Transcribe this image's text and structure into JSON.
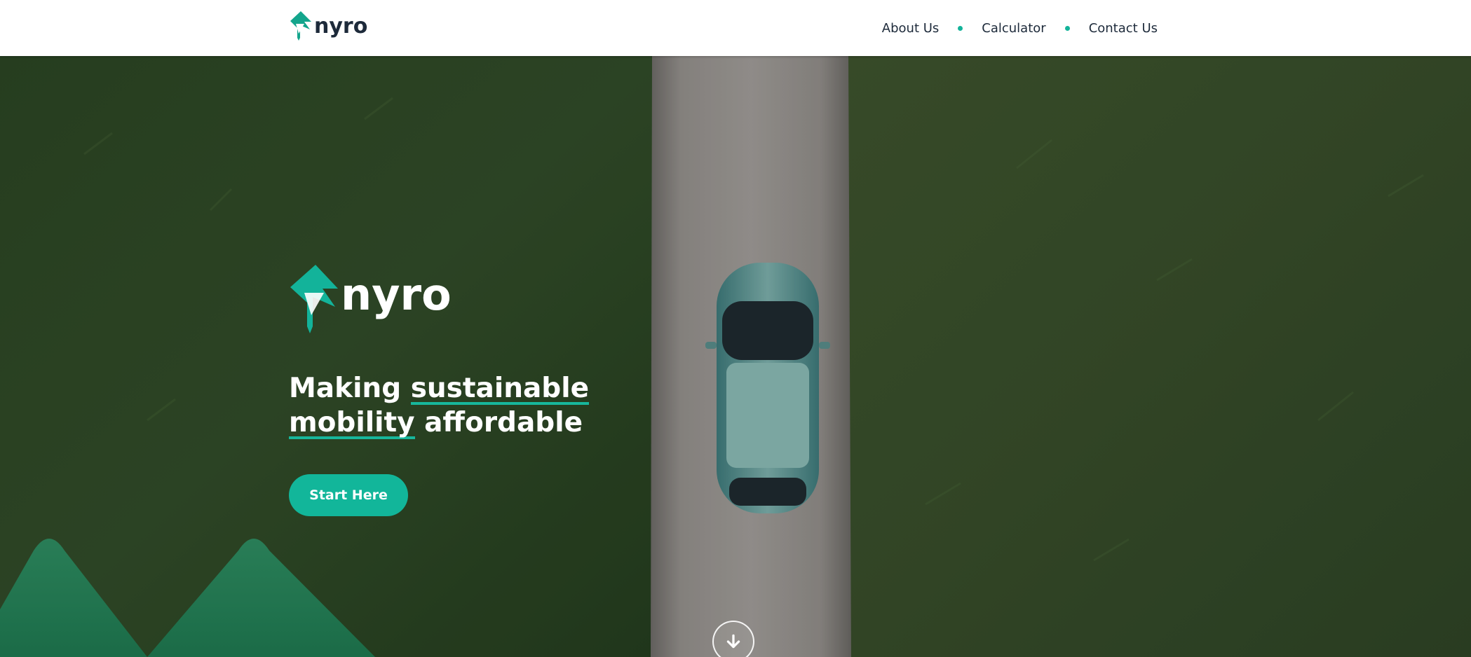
{
  "brand": {
    "name": "nyro",
    "accent_color": "#13b39a",
    "logo_icon": "leaf-bolt-logo-icon"
  },
  "nav": {
    "items": [
      "About Us",
      "Calculator",
      "Contact Us"
    ],
    "separator_icon": "dot-icon"
  },
  "hero": {
    "background": "aerial-road-car-grass-image",
    "headline": {
      "part1": "Making",
      "highlight1": "sustainable",
      "highlight2": "mobility",
      "part2": "affordable"
    },
    "cta_label": "Start Here",
    "scroll_icon": "arrow-down-icon"
  },
  "colors": {
    "header_bg": "#ffffff",
    "grass": "#2e4a27",
    "road": "#8f8c88",
    "car": "#5f9b9a",
    "cta": "#12b69a"
  }
}
